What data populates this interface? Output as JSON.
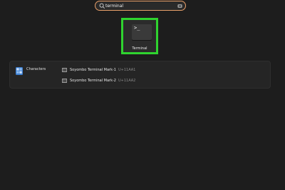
{
  "search": {
    "value": "terminal"
  },
  "app_result": {
    "label": "Terminal",
    "icon": "terminal-icon",
    "prompt": ">_",
    "highlight_color": "#2fd32f"
  },
  "characters": {
    "provider_label": "Characters",
    "provider_icon": "characters-app-icon",
    "items": [
      {
        "name": "Soyombo Terminal Mark-1",
        "code": "U+11AA1",
        "icon": "glyph-icon"
      },
      {
        "name": "Soyombo Terminal Mark-2",
        "code": "U+11AA2",
        "icon": "glyph-icon"
      }
    ]
  },
  "colors": {
    "background": "#1d1d1d",
    "search_border": "#e9a06a",
    "card": "#252525"
  }
}
